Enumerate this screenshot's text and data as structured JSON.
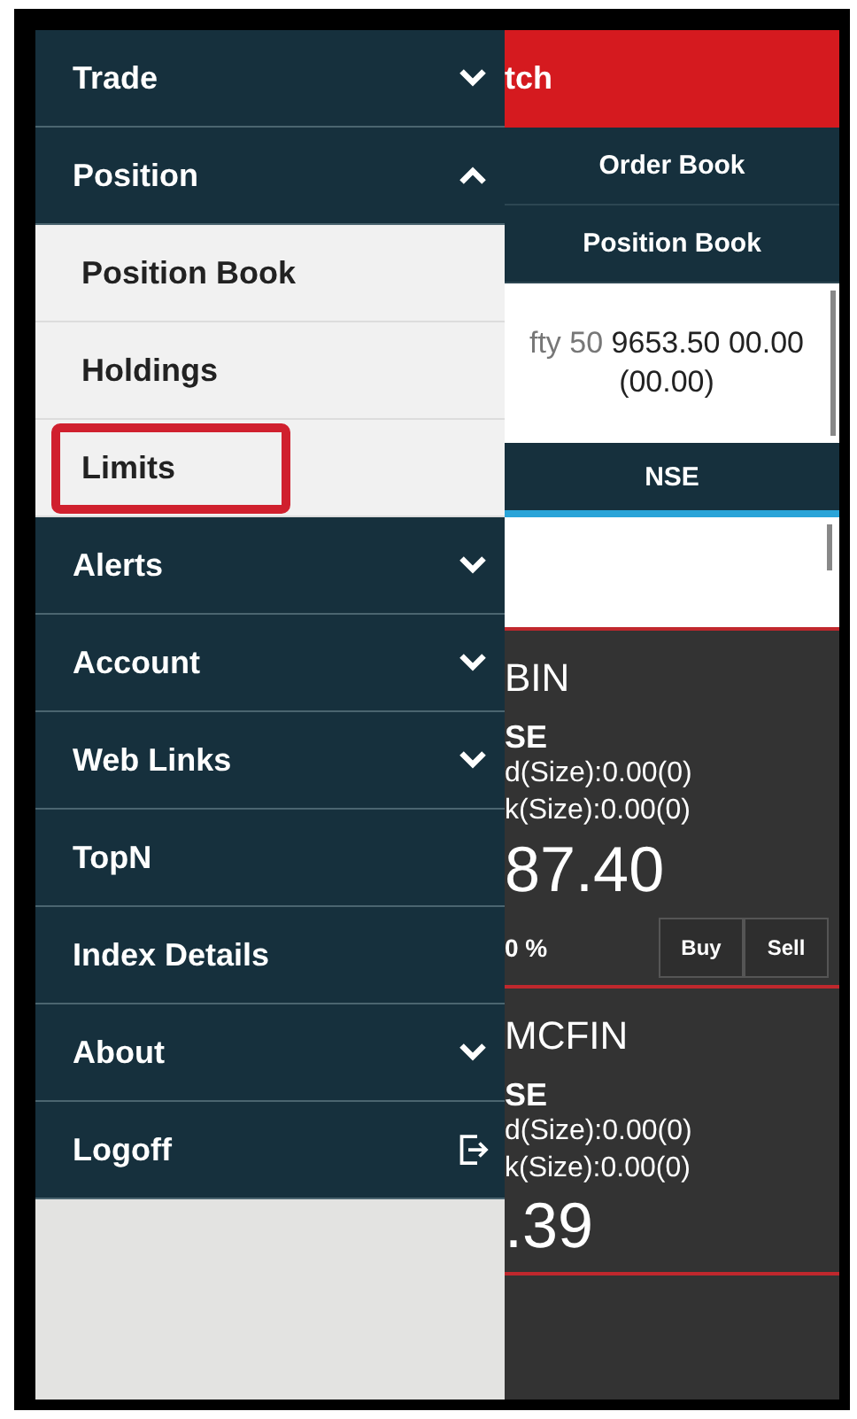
{
  "drawer": {
    "items": [
      {
        "kind": "group",
        "label": "Trade",
        "expanded": false
      },
      {
        "kind": "group",
        "label": "Position",
        "expanded": true
      },
      {
        "kind": "subitem",
        "label": "Position Book",
        "highlighted": false
      },
      {
        "kind": "subitem",
        "label": "Holdings",
        "highlighted": false
      },
      {
        "kind": "subitem",
        "label": "Limits",
        "highlighted": true
      },
      {
        "kind": "group",
        "label": "Alerts",
        "expanded": false
      },
      {
        "kind": "group",
        "label": "Account",
        "expanded": false
      },
      {
        "kind": "group",
        "label": "Web Links",
        "expanded": false
      },
      {
        "kind": "link",
        "label": "TopN"
      },
      {
        "kind": "link",
        "label": "Index Details"
      },
      {
        "kind": "group",
        "label": "About",
        "expanded": false
      },
      {
        "kind": "logoff",
        "label": "Logoff"
      }
    ]
  },
  "app": {
    "header_title": "tch",
    "buttons": [
      "Order Book",
      "Position Book"
    ],
    "index": {
      "name": "fty 50",
      "value": "9653.50 00.00",
      "change": "(00.00)"
    },
    "exchange_tab": "NSE",
    "stocks": [
      {
        "symbol": "BIN",
        "exchange": "SE",
        "bid": "d(Size):0.00(0)",
        "ask": "k(Size):0.00(0)",
        "price": "87.40",
        "change": "0 %",
        "buy": "Buy",
        "sell": "Sell"
      },
      {
        "symbol": "MCFIN",
        "exchange": "SE",
        "bid": "d(Size):0.00(0)",
        "ask": "k(Size):0.00(0)",
        "price": ".39"
      }
    ]
  }
}
